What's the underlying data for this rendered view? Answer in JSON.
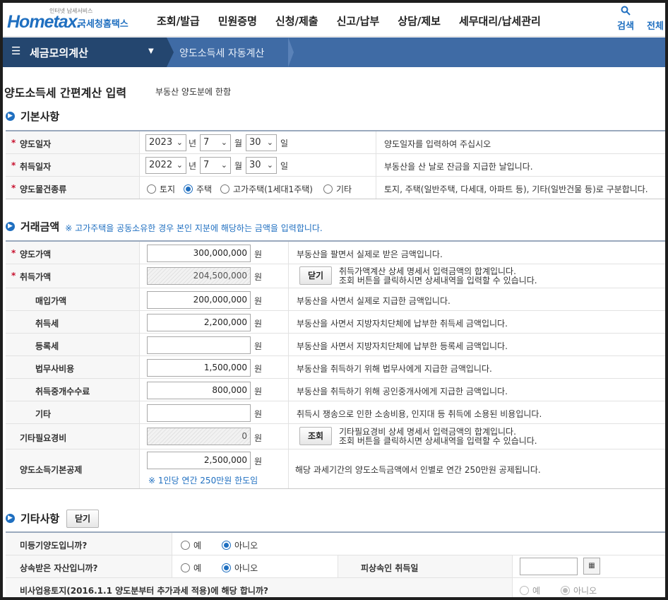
{
  "header": {
    "logo_small": "인터넷 납세서비스",
    "logo_main": "Hometax.",
    "logo_kor": "국세청홈택스",
    "menu": [
      "조회/발급",
      "민원증명",
      "신청/제출",
      "신고/납부",
      "상담/제보",
      "세무대리/납세관리"
    ],
    "search_label": "검색",
    "all_label": "전체"
  },
  "nav": {
    "selected": "세금모의계산",
    "crumb": "양도소득세 자동계산"
  },
  "page": {
    "title": "양도소득세 간편계산 입력",
    "subtitle": "부동산 양도분에 한함"
  },
  "basic": {
    "section_title": "기본사항",
    "transfer_date": {
      "label": "양도일자",
      "year": "2023",
      "month": "7",
      "day": "30",
      "desc": "양도일자를 입력하여 주십시오"
    },
    "acquire_date": {
      "label": "취득일자",
      "year": "2022",
      "month": "7",
      "day": "30",
      "desc": "부동산을 산 날로 잔금을 지급한 날입니다."
    },
    "units": {
      "year": "년",
      "month": "월",
      "day": "일"
    },
    "property_type": {
      "label": "양도물건종류",
      "options": [
        "토지",
        "주택",
        "고가주택(1세대1주택)",
        "기타"
      ],
      "selected": "주택",
      "desc": "토지, 주택(일반주택, 다세대, 아파트 등), 기타(일반건물 등)로 구분합니다."
    }
  },
  "amount": {
    "section_title": "거래금액",
    "section_note": "※ 고가주택을 공동소유한 경우 본인 지분에 해당하는 금액을 입력합니다.",
    "unit": "원",
    "sale": {
      "label": "양도가액",
      "value": "300,000,000",
      "desc": "부동산을 팔면서 실제로 받은 금액입니다."
    },
    "acquire": {
      "label": "취득가액",
      "value": "204,500,000",
      "button": "닫기",
      "desc1": "취득가액계산 상세 명세서 입력금액의 합계입니다.",
      "desc2": "조회 버튼을 클릭하시면 상세내역을 입력할 수 있습니다."
    },
    "purchase": {
      "label": "매입가액",
      "value": "200,000,000",
      "desc": "부동산을 사면서 실제로 지급한 금액입니다."
    },
    "acq_tax": {
      "label": "취득세",
      "value": "2,200,000",
      "desc": "부동산을 사면서 지방자치단체에 납부한 취득세 금액입니다."
    },
    "reg_tax": {
      "label": "등록세",
      "value": "",
      "desc": "부동산을 사면서 지방자치단체에 납부한 등록세 금액입니다."
    },
    "legal": {
      "label": "법무사비용",
      "value": "1,500,000",
      "desc": "부동산을 취득하기 위해 법무사에게 지급한 금액입니다."
    },
    "broker": {
      "label": "취득중개수수료",
      "value": "800,000",
      "desc": "부동산을 취득하기 위해 공인중개사에게 지급한 금액입니다."
    },
    "etc": {
      "label": "기타",
      "value": "",
      "desc": "취득시 쟁송으로 인한 소송비용, 인지대 등 취득에 소용된 비용입니다."
    },
    "other_exp": {
      "label": "기타필요경비",
      "value": "0",
      "button": "조회",
      "desc1": "기타필요경비 상세 명세서 입력금액의 합계입니다.",
      "desc2": "조회 버튼을 클릭하시면 상세내역을 입력할 수 있습니다."
    },
    "basic_deduct": {
      "label": "양도소득기본공제",
      "value": "2,500,000",
      "hint": "※ 1인당 연간 250만원 한도임",
      "desc": "해당 과세기간의 양도소득금액에서 인별로 연간 250만원 공제됩니다."
    }
  },
  "other": {
    "section_title": "기타사항",
    "close_button": "닫기",
    "yes": "예",
    "no": "아니오",
    "q1": "미등기양도입니까?",
    "q2": "상속받은 자산입니까?",
    "q2_side": "피상속인 취득일",
    "q3": "비사업용토지(2016.1.1 양도분부터 추가과세 적용)에 해당 합니까?"
  },
  "colors": {
    "brand": "#1f6fc0",
    "nav": "#3f6ba5",
    "nav_dark": "#24466f",
    "required": "#c8102e"
  }
}
